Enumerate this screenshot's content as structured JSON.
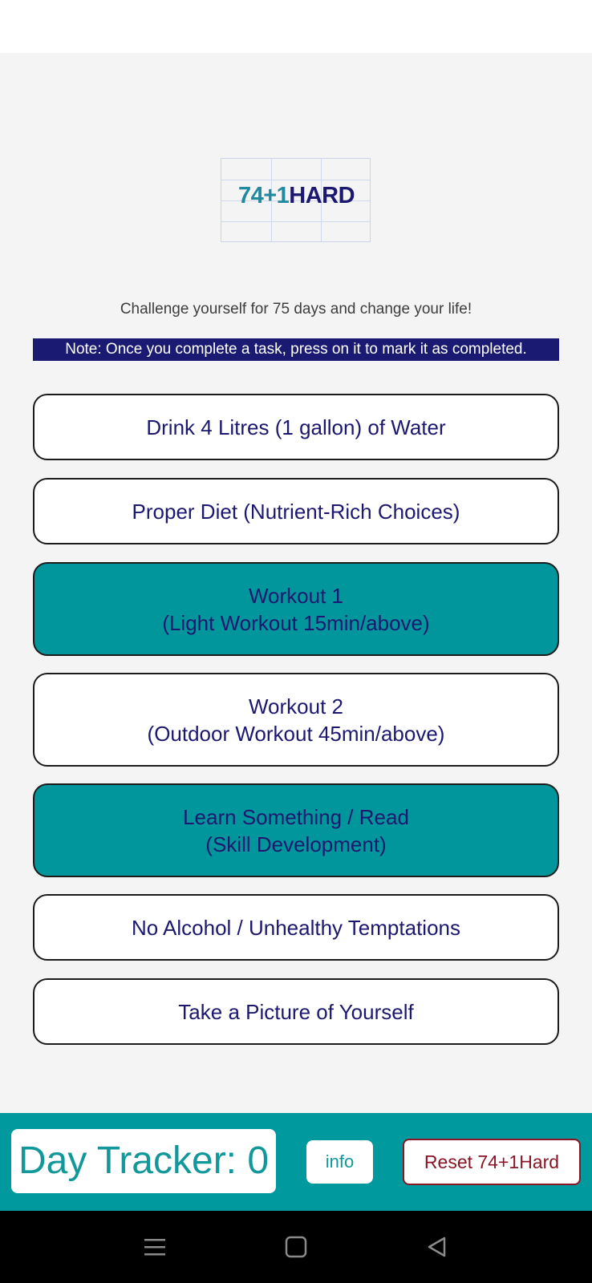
{
  "logo": {
    "number": "74+1",
    "word": "HARD"
  },
  "tagline": "Challenge yourself for 75 days and change your life!",
  "note": "Note: Once you complete a task, press on it to mark it as completed.",
  "tasks": [
    {
      "line1": "Drink 4 Litres (1 gallon) of Water",
      "line2": "",
      "completed": false
    },
    {
      "line1": "Proper Diet (Nutrient-Rich Choices)",
      "line2": "",
      "completed": false
    },
    {
      "line1": "Workout 1",
      "line2": "(Light Workout 15min/above)",
      "completed": true
    },
    {
      "line1": "Workout 2",
      "line2": "(Outdoor Workout 45min/above)",
      "completed": false
    },
    {
      "line1": "Learn Something / Read",
      "line2": "(Skill Development)",
      "completed": true
    },
    {
      "line1": "No Alcohol / Unhealthy Temptations",
      "line2": "",
      "completed": false
    },
    {
      "line1": "Take a Picture of Yourself",
      "line2": "",
      "completed": false
    }
  ],
  "bottom": {
    "day_tracker": "Day Tracker: 0",
    "info_label": "info",
    "reset_label": "Reset 74+1Hard"
  },
  "nav_icons": [
    "menu-icon",
    "home-square-icon",
    "back-triangle-icon"
  ],
  "colors": {
    "accent_teal": "#009a9e",
    "note_bg": "#1a1a72",
    "task_text": "#1c1870",
    "reset_red": "#8a1525"
  }
}
